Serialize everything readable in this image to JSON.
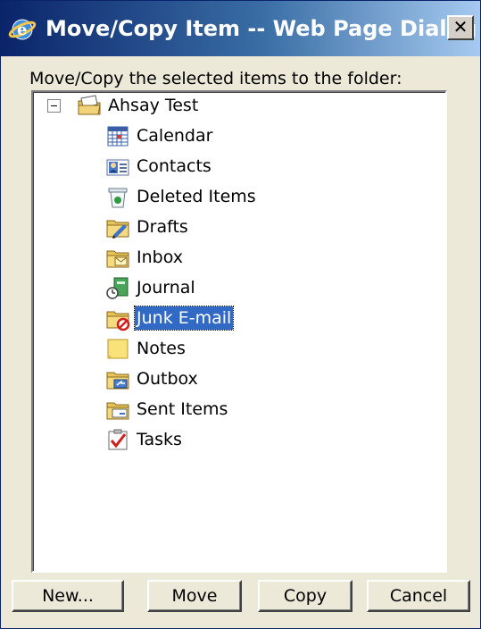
{
  "window": {
    "title": "Move/Copy Item -- Web Page Dialog",
    "close_label": "✕"
  },
  "prompt": "Move/Copy the selected items to the folder:",
  "tree": {
    "root": {
      "label": "Ahsay Test",
      "expanded": true
    },
    "items": [
      {
        "label": "Calendar",
        "icon": "calendar-icon"
      },
      {
        "label": "Contacts",
        "icon": "contacts-icon"
      },
      {
        "label": "Deleted Items",
        "icon": "trash-icon"
      },
      {
        "label": "Drafts",
        "icon": "drafts-folder-icon"
      },
      {
        "label": "Inbox",
        "icon": "inbox-folder-icon"
      },
      {
        "label": "Journal",
        "icon": "journal-icon"
      },
      {
        "label": "Junk E-mail",
        "icon": "junk-folder-icon",
        "selected": true
      },
      {
        "label": "Notes",
        "icon": "notes-icon"
      },
      {
        "label": "Outbox",
        "icon": "outbox-folder-icon"
      },
      {
        "label": "Sent Items",
        "icon": "sent-folder-icon"
      },
      {
        "label": "Tasks",
        "icon": "tasks-icon"
      }
    ]
  },
  "buttons": {
    "new": "New...",
    "move": "Move",
    "copy": "Copy",
    "cancel": "Cancel"
  },
  "colors": {
    "title_gradient_start": "#0a246a",
    "title_gradient_end": "#a6caf0",
    "selection": "#316ac5",
    "dialog_background": "#ece9d8"
  }
}
